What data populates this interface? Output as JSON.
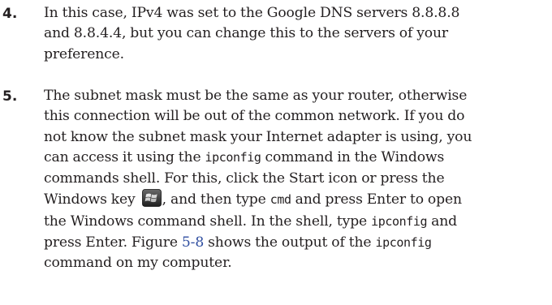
{
  "steps": [
    {
      "number": "4.",
      "lines": [
        "In this case, IPv4 was set to the Google DNS servers 8.8.8.8",
        "and 8.8.4.4, but you can change this to the servers of your",
        "preference."
      ]
    },
    {
      "number": "5.",
      "lines": [
        "The subnet mask must be the same as your router, otherwise",
        "this connection will be out of the common network. If you do",
        "not know the subnet mask your Internet adapter is using, you"
      ],
      "l4_a": "can access it using the ",
      "l4_code": "ipconfig",
      "l4_b": " command in the Windows",
      "l5": "commands shell. For this, click the Start icon or press the",
      "l6_a": "Windows key ",
      "l6_b": ", and then type ",
      "l6_code": "cmd",
      "l6_c": " and press Enter to open",
      "l7_a": "the Windows command shell. In the shell, type ",
      "l7_code": "ipconfig",
      "l7_b": " and",
      "l8_a": "press Enter. Figure ",
      "l8_link": "5-8",
      "l8_b": " shows the output of the ",
      "l8_code": "ipconfig",
      "l9": "command on my computer.",
      "windows_key_icon": "windows-logo-key-icon"
    }
  ]
}
